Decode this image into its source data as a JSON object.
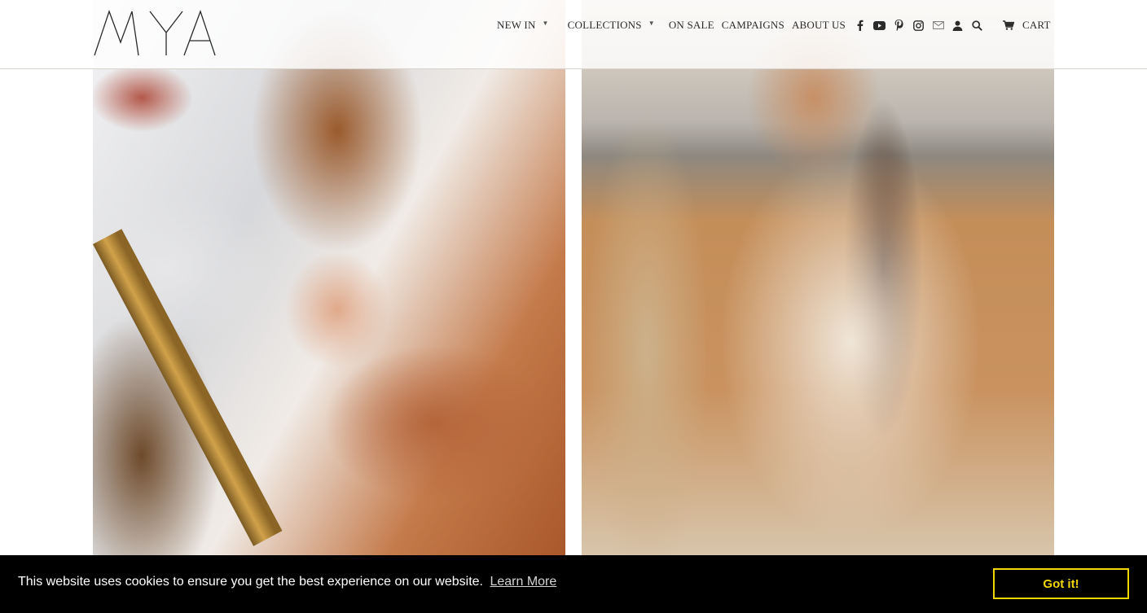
{
  "brand": {
    "logo_text": "MYA"
  },
  "nav": {
    "items": [
      {
        "label": "NEW IN",
        "has_dropdown": true
      },
      {
        "label": "COLLECTIONS",
        "has_dropdown": true
      },
      {
        "label": "ON SALE",
        "has_dropdown": false
      },
      {
        "label": "CAMPAIGNS",
        "has_dropdown": false
      },
      {
        "label": "ABOUT US",
        "has_dropdown": false
      }
    ],
    "social_icons": [
      "facebook-icon",
      "youtube-icon",
      "pinterest-icon",
      "instagram-icon",
      "mail-icon"
    ],
    "account_icon": "user-icon",
    "search_icon": "search-icon",
    "cart_icon": "cart-icon",
    "cart_label": "CART"
  },
  "hero": {
    "images": [
      {
        "subject": "model-with-mirror"
      },
      {
        "subject": "model-on-beach"
      }
    ]
  },
  "cookie_bar": {
    "message": "This website uses cookies to ensure you get the best experience on our website.",
    "link_label": "Learn More",
    "button_label": "Got it!",
    "accent_color": "#f1d600"
  }
}
